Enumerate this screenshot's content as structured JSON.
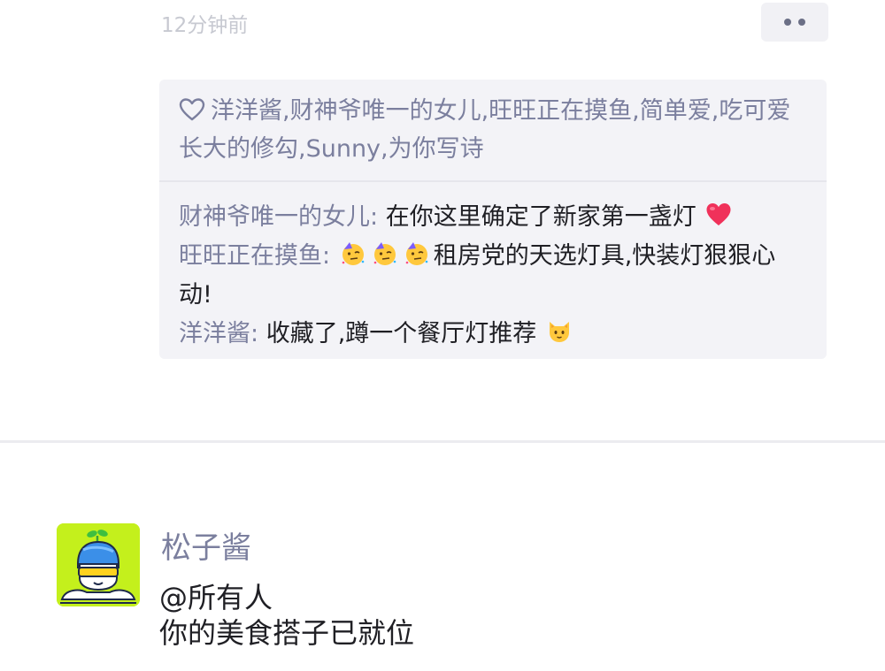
{
  "post": {
    "timestamp": "12分钟前",
    "more_icon": "more-dots-icon"
  },
  "likes": {
    "icon": "heart-outline-icon",
    "names": "洋洋酱,财神爷唯一的女儿,旺旺正在摸鱼,简单爱,吃可爱长大的修勾,Sunny,为你写诗"
  },
  "comments": [
    {
      "author": "财神爷唯一的女儿:",
      "text": "在你这里确定了新家第一盏灯",
      "emoji_after": "red-heart-emoji"
    },
    {
      "author": "旺旺正在摸鱼:",
      "emoji_before": [
        "partying-face-emoji",
        "partying-face-emoji",
        "partying-face-emoji"
      ],
      "text": "租房党的天选灯具,快装灯狠狠心动!"
    },
    {
      "author": "洋洋酱:",
      "text": "收藏了,蹲一个餐厅灯推荐",
      "emoji_after": "cat-face-emoji"
    }
  ],
  "new_post": {
    "author": "松子酱",
    "avatar_icon": "sprout-boy-avatar-icon",
    "line1": "@所有人",
    "line2": "你的美食搭子已就位"
  },
  "colors": {
    "link": "#7b7f9e",
    "box_bg": "#f3f3f7",
    "avatar_bg": "#c4f01c",
    "text": "#1f1f24"
  }
}
